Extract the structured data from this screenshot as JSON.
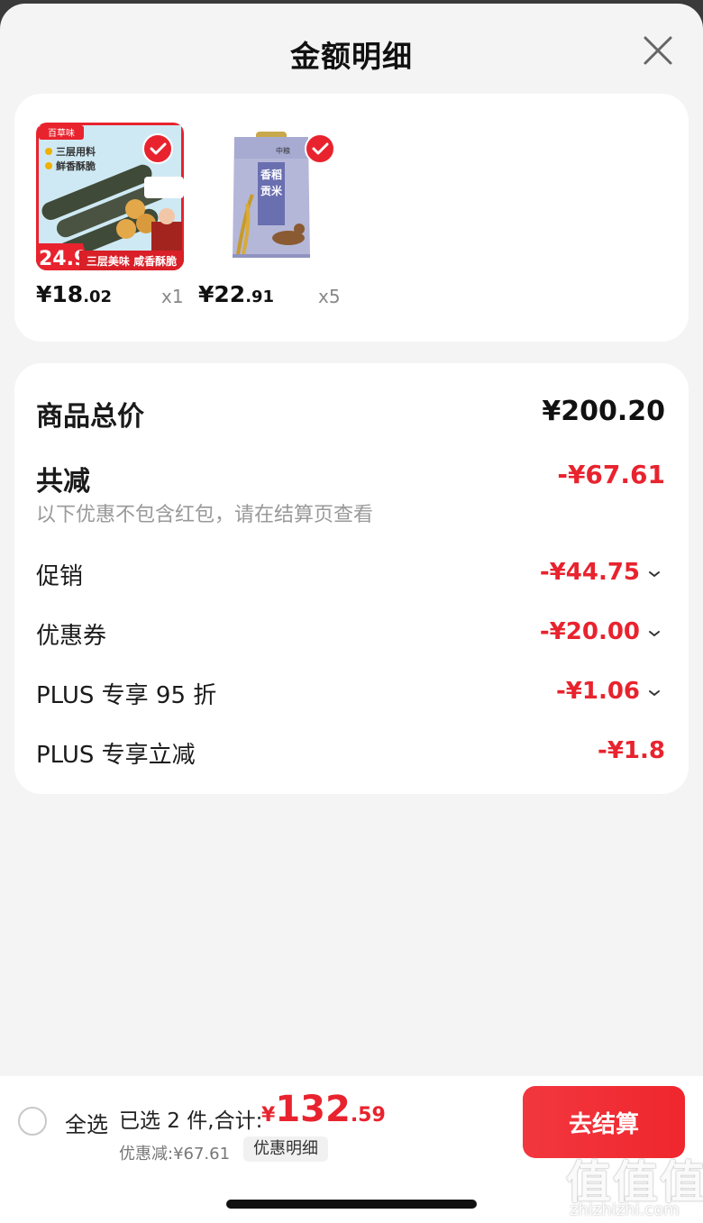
{
  "header": {
    "title": "金额明细"
  },
  "products": [
    {
      "price_int": "¥18",
      "price_cents": ".02",
      "qty": "x1",
      "image": "seaweed-snack-image",
      "thumb_text": {
        "brand": "百草味",
        "l1": "三层用料",
        "l2": "鲜香酥脆",
        "badge": "24.9",
        "bottom": "三层美味 咸香酥脆"
      }
    },
    {
      "price_int": "¥22",
      "price_cents": ".91",
      "qty": "x5",
      "image": "rice-bag-image",
      "thumb_text": {
        "brand": "中粮",
        "name": "香稻贡米"
      }
    }
  ],
  "summary": {
    "total_label": "商品总价",
    "total_value": "¥200.20",
    "reduce_label": "共减",
    "reduce_value": "-¥67.61",
    "note": "以下优惠不包含红包，请在结算页查看",
    "lines": [
      {
        "label": "促销",
        "value": "-¥44.75"
      },
      {
        "label": "优惠券",
        "value": "-¥20.00"
      },
      {
        "label": "PLUS 专享 95 折",
        "value": "-¥1.06"
      },
      {
        "label": "PLUS 专享立减",
        "value": "-¥1.8"
      }
    ]
  },
  "footer": {
    "select_all": "全选",
    "selected_info": "已选 2 件,合计:",
    "total_yen": "¥",
    "total_int": "132",
    "total_dec": ".59",
    "discount": "优惠减:¥67.61",
    "detail_tag": "优惠明细",
    "checkout": "去结算"
  },
  "watermark": {
    "glyphs": "值值值",
    "text": "zhizhizhi.com"
  },
  "colors": {
    "accent": "#e8232e",
    "background": "#f4f4f4",
    "card": "#ffffff"
  }
}
